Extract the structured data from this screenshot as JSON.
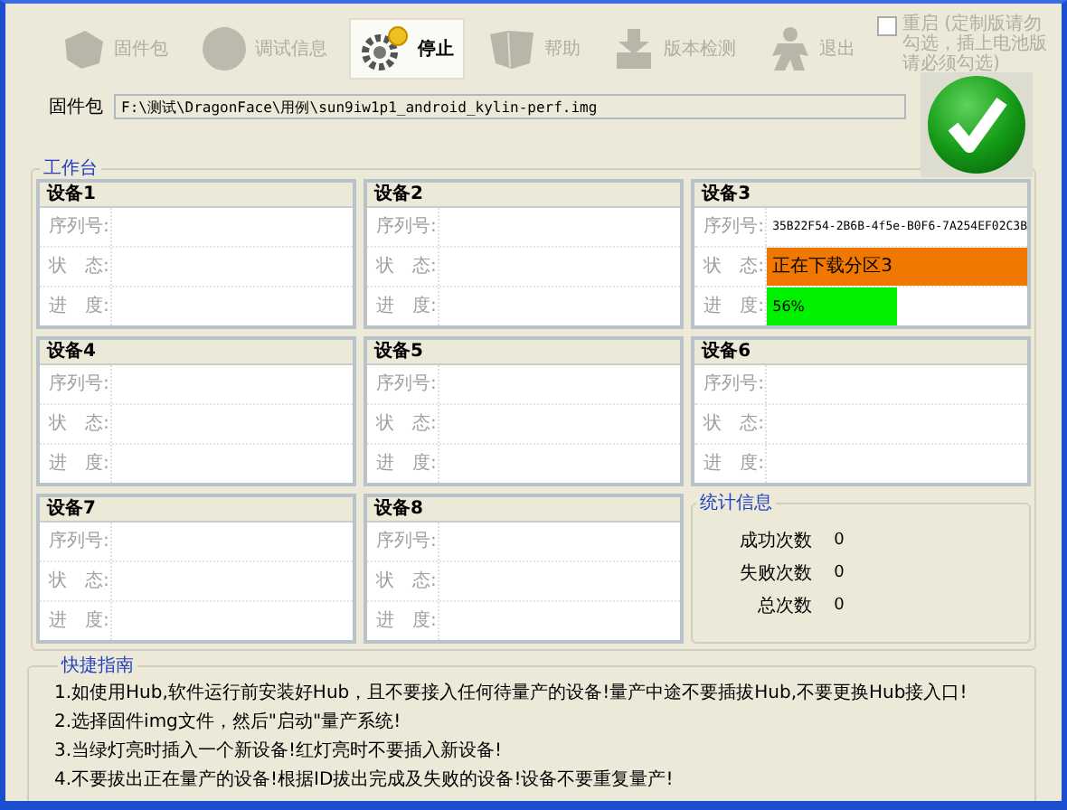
{
  "toolbar": [
    {
      "label": "固件包",
      "disabled": true,
      "selected": false
    },
    {
      "label": "调试信息",
      "disabled": true,
      "selected": false
    },
    {
      "label": "停止",
      "disabled": false,
      "selected": true
    },
    {
      "label": "帮助",
      "disabled": true,
      "selected": false
    },
    {
      "label": "版本检测",
      "disabled": true,
      "selected": false
    },
    {
      "label": "退出",
      "disabled": true,
      "selected": false
    }
  ],
  "reboot_option": {
    "label": "重启 (定制版请勿勾选，插上电池版请必须勾选)",
    "checked": false
  },
  "firmware": {
    "label": "固件包",
    "value": "F:\\测试\\DragonFace\\用例\\sun9iw1p1_android_kylin-perf.img"
  },
  "workbench": {
    "title": "工作台",
    "devices": [
      {
        "title": "设备1",
        "serial_label": "序列号:",
        "status_label": "状　态:",
        "progress_label": "进　度:"
      },
      {
        "title": "设备2",
        "serial_label": "序列号:",
        "status_label": "状　态:",
        "progress_label": "进　度:"
      },
      {
        "title": "设备3",
        "serial_label": "序列号:",
        "status_label": "状　态:",
        "progress_label": "进　度:",
        "serial": "35B22F54-2B6B-4f5e-B0F6-7A254EF02C3B",
        "status": {
          "text": "正在下载分区3",
          "color": "#f07800"
        },
        "progress": {
          "level": 0.5,
          "reading": "56%"
        }
      },
      {
        "title": "设备4",
        "serial_label": "序列号:",
        "status_label": "状　态:",
        "progress_label": "进　度:"
      },
      {
        "title": "设备5",
        "serial_label": "序列号:",
        "status_label": "状　态:",
        "progress_label": "进　度:"
      },
      {
        "title": "设备6",
        "serial_label": "序列号:",
        "status_label": "状　态:",
        "progress_label": "进　度:"
      },
      {
        "title": "设备7",
        "serial_label": "序列号:",
        "status_label": "状　态:",
        "progress_label": "进　度:"
      },
      {
        "title": "设备8",
        "serial_label": "序列号:",
        "status_label": "状　态:",
        "progress_label": "进　度:"
      }
    ],
    "stats": {
      "title": "统计信息",
      "rows": [
        {
          "label": "成功次数",
          "value": "0"
        },
        {
          "label": "失败次数",
          "value": "0"
        },
        {
          "label": "总次数",
          "value": "0"
        }
      ]
    }
  },
  "guide": {
    "title": "快捷指南",
    "lines": [
      "1.如使用Hub,软件运行前安装好Hub，且不要接入任何待量产的设备!量产中途不要插拔Hub,不要更换Hub接入口!",
      "2.选择固件img文件，然后\"启动\"量产系统!",
      "3.当绿灯亮时插入一个新设备!红灯亮时不要插入新设备!",
      "4.不要拔出正在量产的设备!根据ID拔出完成及失败的设备!设备不要重复量产!"
    ]
  }
}
